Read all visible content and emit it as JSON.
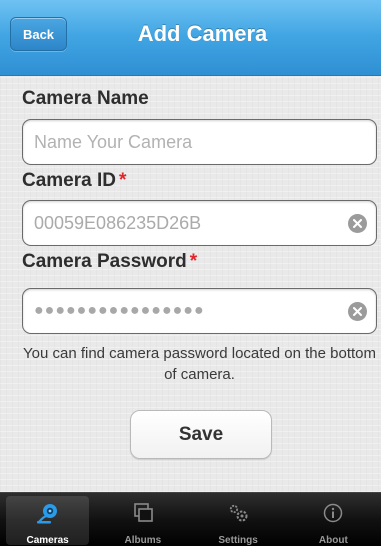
{
  "nav": {
    "back_label": "Back",
    "title": "Add Camera"
  },
  "form": {
    "camera_name_label": "Camera Name",
    "camera_name_placeholder": "Name Your Camera",
    "camera_id_label": "Camera ID",
    "camera_id_value": "00059E086235D26B",
    "camera_password_label": "Camera Password",
    "camera_password_value": "●●●●●●●●●●●●●●●●",
    "required_marker": "*",
    "hint": "You can find camera password located on the bottom of camera.",
    "save_label": "Save"
  },
  "tabs": [
    {
      "label": "Cameras",
      "icon": "camera-icon",
      "active": true
    },
    {
      "label": "Albums",
      "icon": "albums-icon",
      "active": false
    },
    {
      "label": "Settings",
      "icon": "gears-icon",
      "active": false
    },
    {
      "label": "About",
      "icon": "info-icon",
      "active": false
    }
  ],
  "colors": {
    "nav_blue": "#41a5e3",
    "required_red": "#e0262b",
    "tab_active": "#2a9be8"
  }
}
